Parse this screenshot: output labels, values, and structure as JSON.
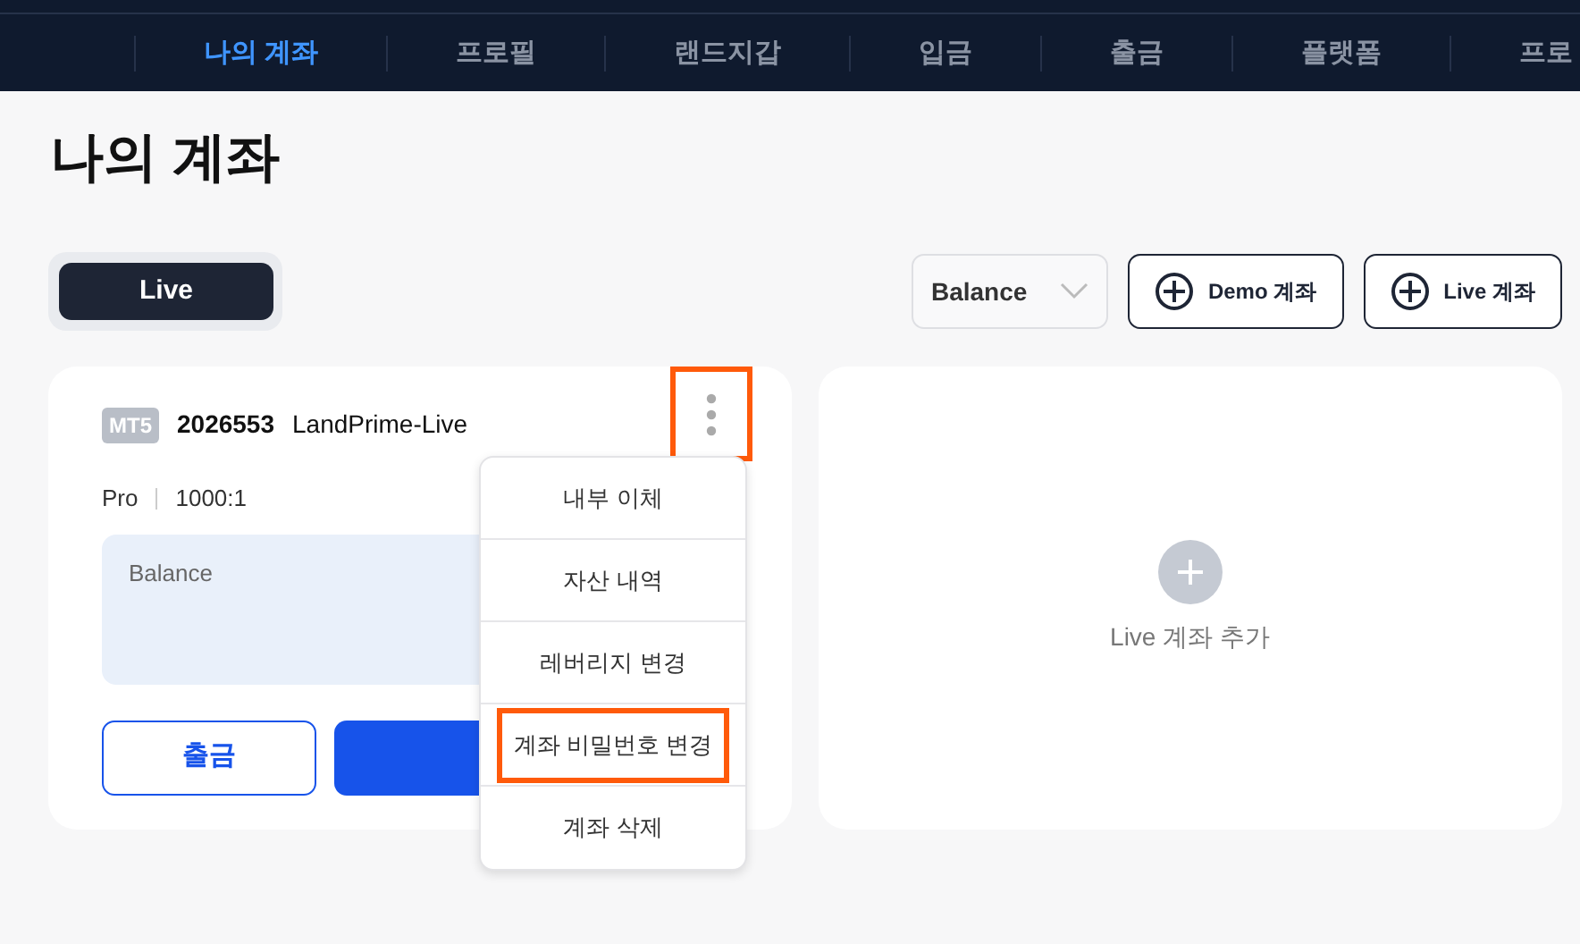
{
  "nav": {
    "items": [
      {
        "label": "나의 계좌",
        "selected": true
      },
      {
        "label": "프로필",
        "selected": false
      },
      {
        "label": "랜드지갑",
        "selected": false
      },
      {
        "label": "입금",
        "selected": false
      },
      {
        "label": "출금",
        "selected": false
      },
      {
        "label": "플랫폼",
        "selected": false
      },
      {
        "label": "프로",
        "selected": false
      }
    ]
  },
  "page_title": "나의 계좌",
  "account_tabs": [
    {
      "label": "Live",
      "selected": true
    }
  ],
  "sort_select": {
    "value": "Balance"
  },
  "add_buttons": [
    {
      "label": "Demo 계좌"
    },
    {
      "label": "Live 계좌"
    }
  ],
  "account_card": {
    "platform": "MT5",
    "number": "2026553",
    "server": "LandPrime-Live",
    "type": "Pro",
    "leverage": "1000:1",
    "balance_label": "Balance",
    "withdraw_button": "출금",
    "more_highlighted": true,
    "menu": [
      {
        "label": "내부 이체",
        "highlighted": false
      },
      {
        "label": "자산 내역",
        "highlighted": false
      },
      {
        "label": "레버리지 변경",
        "highlighted": false
      },
      {
        "label": "계좌 비밀번호 변경",
        "highlighted": true
      },
      {
        "label": "계좌 삭제",
        "highlighted": false
      }
    ]
  },
  "add_card": {
    "label": "Live 계좌 추가"
  }
}
